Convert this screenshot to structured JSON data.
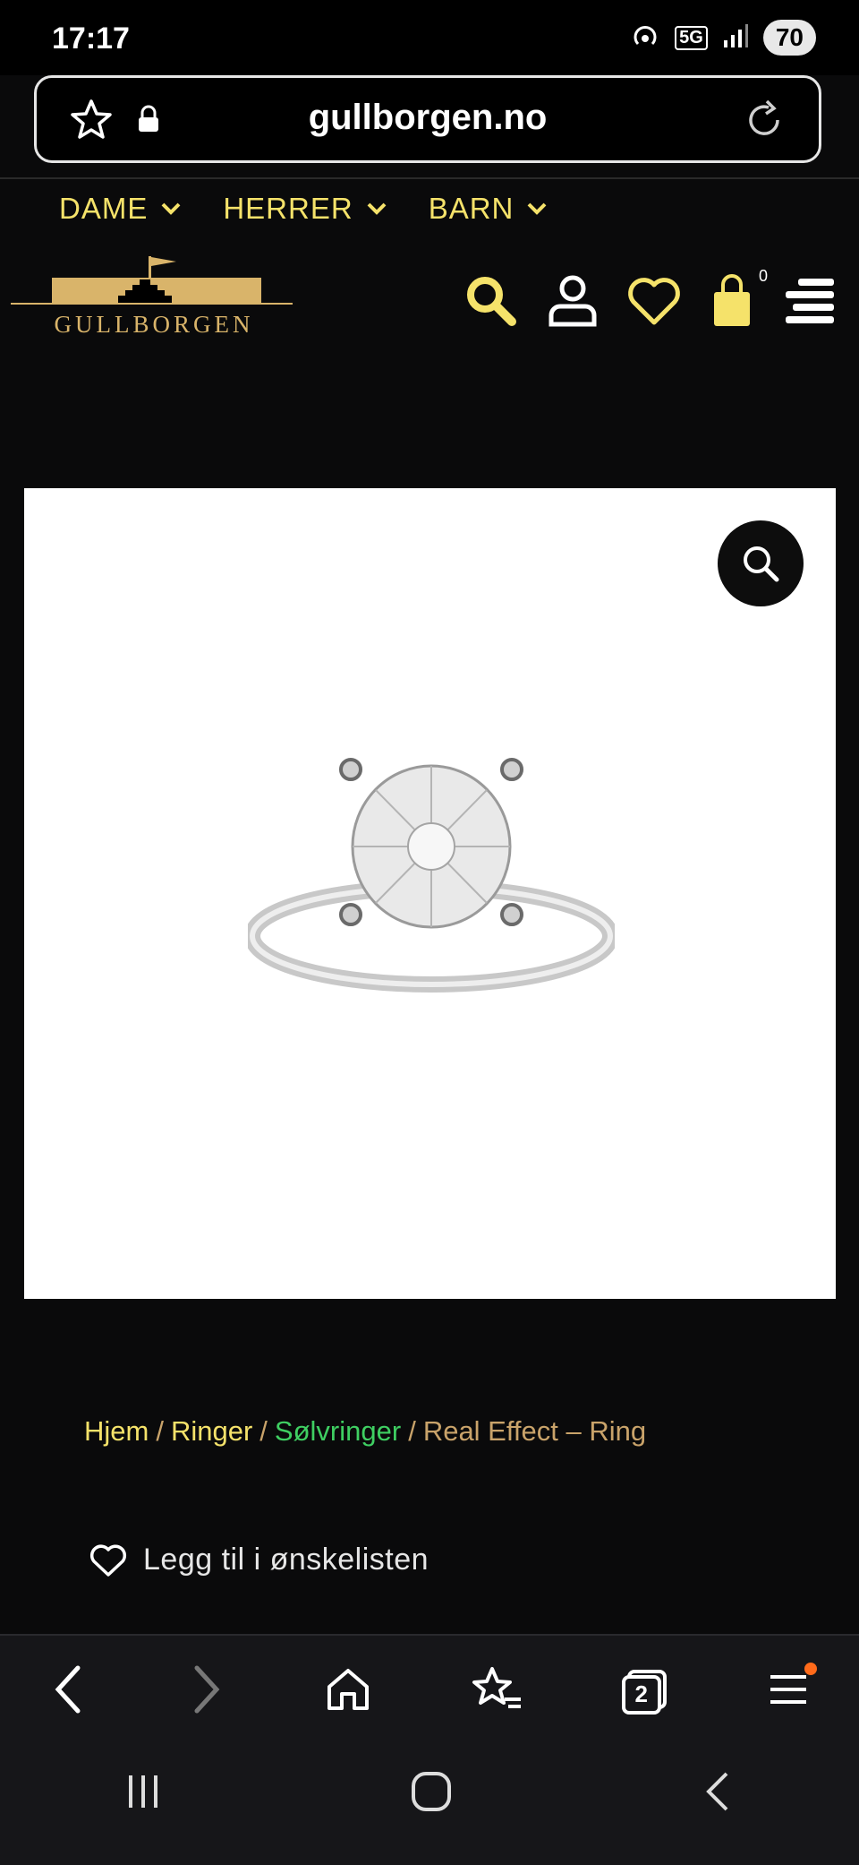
{
  "status_bar": {
    "time": "17:17",
    "network": "5G",
    "battery": "70"
  },
  "browser": {
    "url": "gullborgen.no"
  },
  "nav": {
    "items": [
      {
        "label": "DAME"
      },
      {
        "label": "HERRER"
      },
      {
        "label": "BARN"
      }
    ]
  },
  "header": {
    "logo_text": "GULLBORGEN",
    "cart_count": "0"
  },
  "breadcrumb": {
    "items": [
      "Hjem",
      "Ringer",
      "Sølvringer",
      "Real Effect – Ring"
    ],
    "separator": "/"
  },
  "wishlist": {
    "label": "Legg til i ønskelisten"
  },
  "bottom_bar": {
    "tab_count": "2"
  },
  "colors": {
    "accent_yellow": "#f5e26a",
    "breadcrumb_green": "#3fcf62",
    "breadcrumb_tan": "#c9a36a",
    "logo_gold": "#d9b46a"
  }
}
